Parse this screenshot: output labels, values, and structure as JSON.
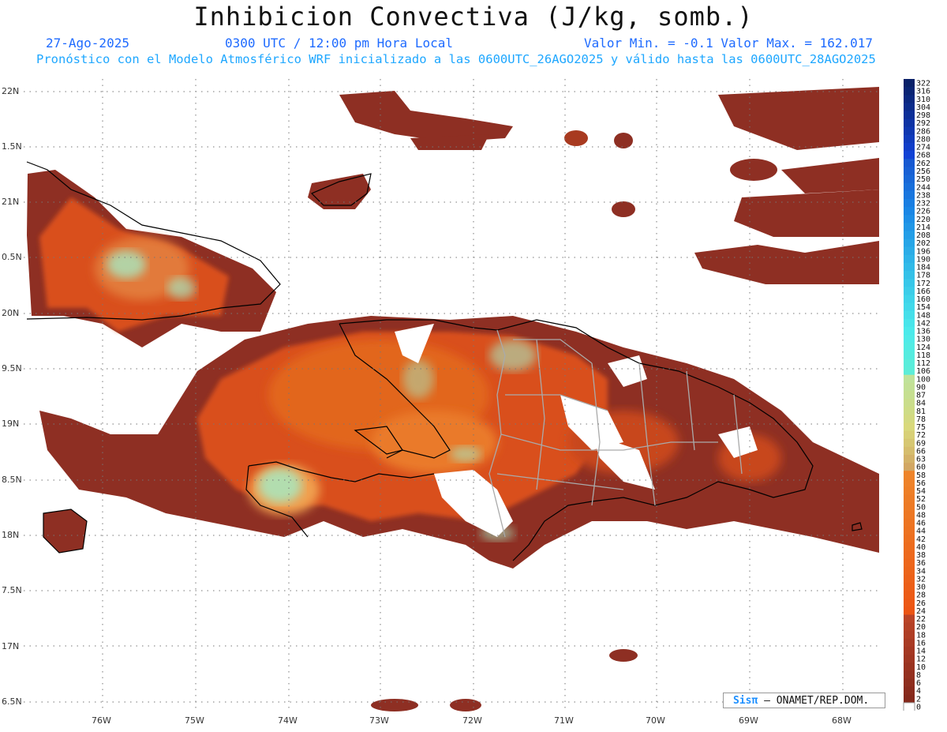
{
  "title": "Inhibicion Convectiva (J/kg, somb.)",
  "date": "27-Ago-2025",
  "time": "0300 UTC / 12:00 pm Hora Local",
  "minmax": "Valor Min. = -0.1  Valor Max. = 162.017",
  "subtitle": "Pronóstico con el Modelo Atmosférico WRF inicializado a las 0600UTC_26AGO2025 y válido hasta las  0600UTC_28AGO2025",
  "map": {
    "lon_labels": [
      "76W",
      "75W",
      "74W",
      "73W",
      "72W",
      "71W",
      "70W",
      "69W",
      "68W"
    ],
    "lat_labels": [
      "22N",
      "1.5N",
      "21N",
      "0.5N",
      "20N",
      "9.5N",
      "19N",
      "8.5N",
      "18N",
      "7.5N",
      "17N",
      "6.5N"
    ],
    "lon_range": [
      -76.8,
      -67.5
    ],
    "lat_range": [
      16.5,
      22.1
    ],
    "land_color": "#8e2f23",
    "warm_color": "#e8531a",
    "peak_color": "#a8e8c0"
  },
  "colorbar": {
    "labels": [
      "322",
      "316",
      "310",
      "304",
      "298",
      "292",
      "286",
      "280",
      "274",
      "268",
      "262",
      "256",
      "250",
      "244",
      "238",
      "232",
      "226",
      "220",
      "214",
      "208",
      "202",
      "196",
      "190",
      "184",
      "178",
      "172",
      "166",
      "160",
      "154",
      "148",
      "142",
      "136",
      "130",
      "124",
      "118",
      "112",
      "106",
      "100",
      "90",
      "87",
      "84",
      "81",
      "78",
      "75",
      "72",
      "69",
      "66",
      "63",
      "60",
      "58",
      "56",
      "54",
      "52",
      "50",
      "48",
      "46",
      "44",
      "42",
      "40",
      "38",
      "36",
      "34",
      "32",
      "30",
      "28",
      "26",
      "24",
      "22",
      "20",
      "18",
      "16",
      "14",
      "12",
      "10",
      "8",
      "6",
      "4",
      "2",
      "0"
    ]
  },
  "logo": {
    "brand": "Sisπ",
    "org": "– ONAMET/REP.DOM."
  }
}
